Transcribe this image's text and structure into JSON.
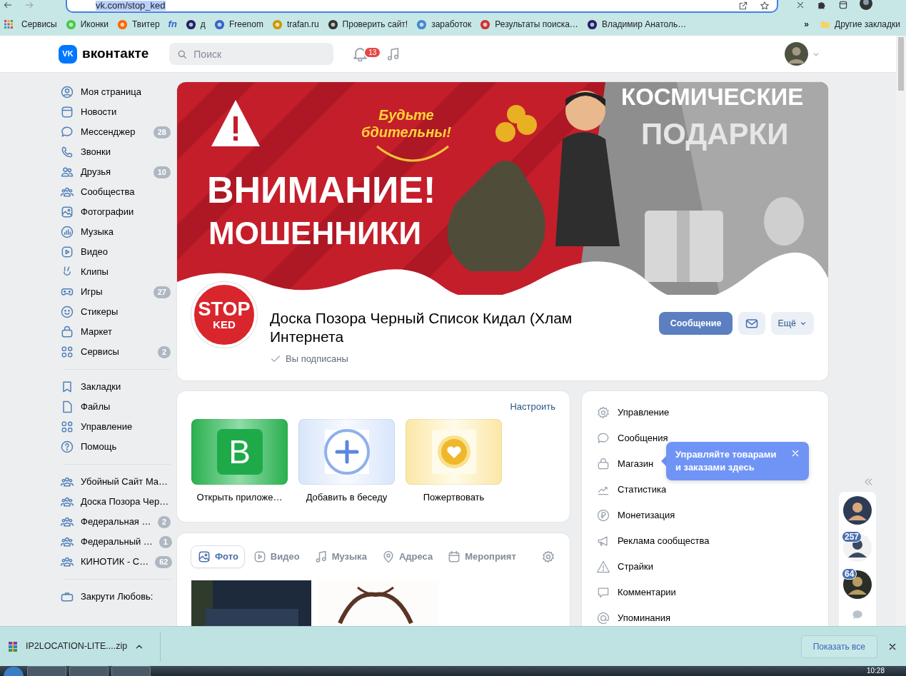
{
  "browser": {
    "url": "vk.com/stop_ked",
    "bookmarks": [
      {
        "label": "Сервисы"
      },
      {
        "label": "Иконки"
      },
      {
        "label": "Твитер"
      },
      {
        "icon_text": "fn"
      },
      {
        "label": "д"
      },
      {
        "label": "Freenom"
      },
      {
        "label": "trafan.ru"
      },
      {
        "label": "Проверить сайт!"
      },
      {
        "label": "заработок"
      },
      {
        "label": "Результаты поиска…"
      },
      {
        "label": "Владимир Анатоль…"
      }
    ],
    "overflow": "»",
    "other_bookmarks": "Другие закладки"
  },
  "header": {
    "logo_mark": "VK",
    "logo": "вконтакте",
    "search": {
      "placeholder": "Поиск"
    },
    "notifications": "13"
  },
  "sidebar": {
    "sections": [
      {
        "items": [
          {
            "label": "Моя страница"
          },
          {
            "label": "Новости"
          },
          {
            "label": "Мессенджер",
            "count": "28"
          },
          {
            "label": "Звонки"
          },
          {
            "label": "Друзья",
            "count": "10"
          },
          {
            "label": "Сообщества"
          },
          {
            "label": "Фотографии"
          },
          {
            "label": "Музыка"
          },
          {
            "label": "Видео"
          },
          {
            "label": "Клипы"
          },
          {
            "label": "Игры",
            "count": "27"
          },
          {
            "label": "Стикеры"
          },
          {
            "label": "Маркет"
          },
          {
            "label": "Сервисы",
            "count": "2"
          }
        ]
      },
      {
        "items": [
          {
            "label": "Закладки"
          },
          {
            "label": "Файлы"
          },
          {
            "label": "Управление"
          },
          {
            "label": "Помощь"
          }
        ]
      },
      {
        "items": [
          {
            "label": "Убойный Сайт Ма…"
          },
          {
            "label": "Доска Позора Чер…"
          },
          {
            "label": "Федеральная …",
            "count": "2"
          },
          {
            "label": "Федеральный …",
            "count": "1"
          },
          {
            "label": "КИНОТИК - С…",
            "count": "62"
          }
        ]
      },
      {
        "items": [
          {
            "label": "Закрути Любовь:"
          }
        ]
      }
    ]
  },
  "cover": {
    "slogan": "Будьте\nбдительны!",
    "title": "ВНИМАНИЕ!",
    "subtitle": "МОШЕННИКИ",
    "side_title": "КОСМИЧЕСКИЕ",
    "side_subtitle": "ПОДАРКИ"
  },
  "community": {
    "avatar_text": [
      "STOP",
      "KED"
    ],
    "name": "Доска Позора Черный Список Кидал (Хлам Интернета",
    "subscribed": true,
    "status": "Вы подписаны",
    "message_button": "Сообщение",
    "more_button": "Ещё"
  },
  "quick_actions": {
    "settings_link": "Настроить",
    "items": [
      {
        "kind": "app",
        "icon_text": "B",
        "label": "Открыть приложе…"
      },
      {
        "kind": "add",
        "label": "Добавить в беседу"
      },
      {
        "kind": "donate",
        "label": "Пожертвовать"
      }
    ]
  },
  "media": {
    "tabs": [
      {
        "label": "Фото",
        "selected": true
      },
      {
        "label": "Видео",
        "selected": false
      },
      {
        "label": "Музыка",
        "selected": false
      },
      {
        "label": "Адреса",
        "selected": false
      },
      {
        "label": "Мероприят",
        "selected": false
      }
    ]
  },
  "manage_menu": {
    "items": [
      {
        "label": "Управление"
      },
      {
        "label": "Сообщения"
      },
      {
        "label": "Магазин"
      },
      {
        "label": "Статистика"
      },
      {
        "label": "Монетизация"
      },
      {
        "label": "Реклама сообщества"
      },
      {
        "label": "Страйки"
      },
      {
        "label": "Комментарии"
      },
      {
        "label": "Упоминания"
      }
    ]
  },
  "tooltip": {
    "text": "Управляйте товарами\nи заказами здесь"
  },
  "chats": [
    {
      "kind": "avatar"
    },
    {
      "kind": "avatar",
      "badge": "257"
    },
    {
      "kind": "avatar",
      "badge": "64"
    }
  ],
  "downloads": {
    "file": "IP2LOCATION-LITE....zip",
    "show_all": "Показать все"
  },
  "taskbar": {
    "clock": "10:28"
  }
}
